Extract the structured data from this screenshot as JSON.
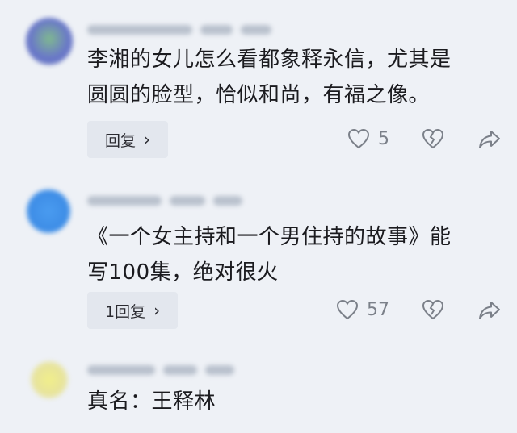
{
  "colors": {
    "background": "#eef1f6",
    "text": "#1b1b1f",
    "muted": "#7b8089",
    "reply_bg": "#e3e7ee"
  },
  "comments": [
    {
      "text_lines": [
        "李湘的女儿怎么看都象释永信，尤其是",
        "圆圆的脸型，恰似和尚，有福之像。"
      ],
      "reply_label": "回复",
      "like_count": "5",
      "icons": [
        "heart-icon",
        "broken-heart-icon",
        "share-icon"
      ]
    },
    {
      "text_lines": [
        "《一个女主持和一个男住持的故事》能",
        "写100集，绝对很火"
      ],
      "reply_label": "1回复",
      "like_count": "57",
      "icons": [
        "heart-icon",
        "broken-heart-icon",
        "share-icon"
      ]
    },
    {
      "text_lines": [
        "真名：王释林"
      ]
    }
  ]
}
